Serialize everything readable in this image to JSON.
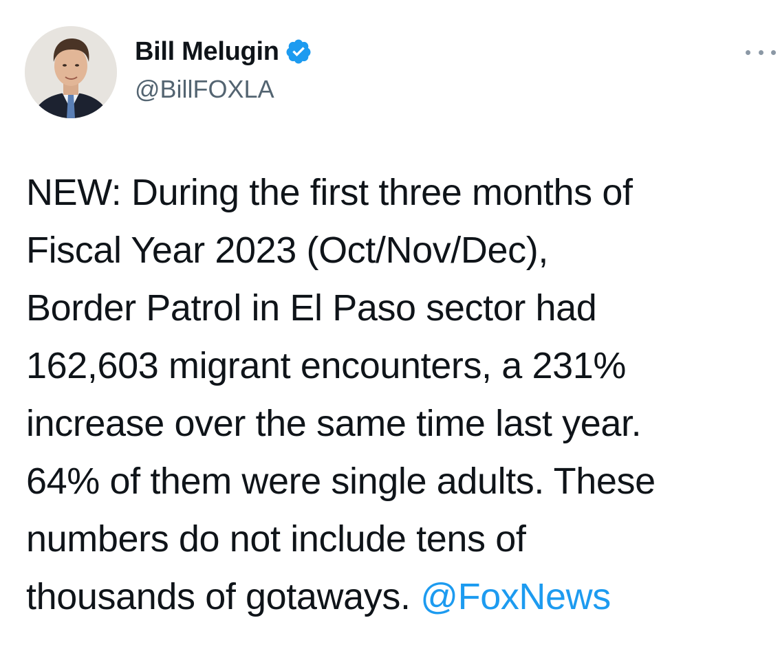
{
  "tweet": {
    "author": {
      "display_name": "Bill Melugin",
      "handle": "@BillFOXLA",
      "verified": true,
      "verified_icon": "verified-badge-icon",
      "avatar_icon": "profile-photo"
    },
    "more_icon": "more-options-icon",
    "text_lines": [
      "NEW: During the first three months of",
      "Fiscal Year 2023 (Oct/Nov/Dec),",
      "Border Patrol in El Paso sector had",
      "162,603 migrant encounters, a 231%",
      "increase over the same time last year.",
      "64% of them were single adults. These",
      "numbers do not include tens of",
      "thousands of gotaways. "
    ],
    "mention": "@FoxNews"
  },
  "colors": {
    "text": "#0f1419",
    "secondary": "#536471",
    "link": "#1d9bf0",
    "verified": "#1d9bf0"
  }
}
